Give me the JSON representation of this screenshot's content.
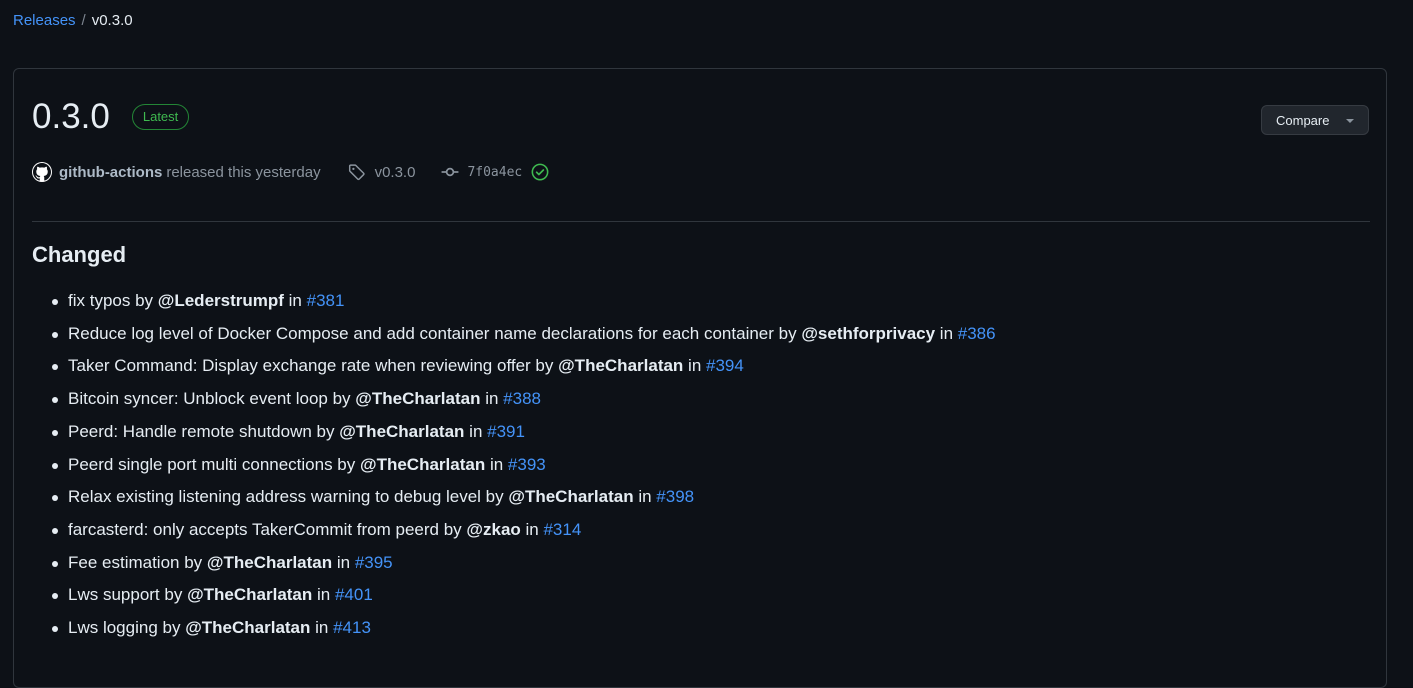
{
  "breadcrumb": {
    "parent": "Releases",
    "separator": "/",
    "current": "v0.3.0"
  },
  "release": {
    "title": "0.3.0",
    "badge": "Latest",
    "compare_label": "Compare",
    "author": "github-actions",
    "released_text": "released this yesterday",
    "tag": "v0.3.0",
    "commit": "7f0a4ec"
  },
  "section": {
    "heading": "Changed",
    "items": [
      {
        "text": "fix typos by ",
        "user": "@Lederstrumpf",
        "in": " in ",
        "pr": "#381"
      },
      {
        "text": "Reduce log level of Docker Compose and add container name declarations for each container by ",
        "user": "@sethforprivacy",
        "in": " in ",
        "pr": "#386"
      },
      {
        "text": "Taker Command: Display exchange rate when reviewing offer by ",
        "user": "@TheCharlatan",
        "in": " in ",
        "pr": "#394"
      },
      {
        "text": "Bitcoin syncer: Unblock event loop by ",
        "user": "@TheCharlatan",
        "in": " in ",
        "pr": "#388"
      },
      {
        "text": "Peerd: Handle remote shutdown by ",
        "user": "@TheCharlatan",
        "in": " in ",
        "pr": "#391"
      },
      {
        "text": "Peerd single port multi connections by ",
        "user": "@TheCharlatan",
        "in": " in ",
        "pr": "#393"
      },
      {
        "text": "Relax existing listening address warning to debug level by ",
        "user": "@TheCharlatan",
        "in": " in ",
        "pr": "#398"
      },
      {
        "text": "farcasterd: only accepts TakerCommit from peerd by ",
        "user": "@zkao",
        "in": " in ",
        "pr": "#314"
      },
      {
        "text": "Fee estimation by ",
        "user": "@TheCharlatan",
        "in": " in ",
        "pr": "#395"
      },
      {
        "text": "Lws support by ",
        "user": "@TheCharlatan",
        "in": " in ",
        "pr": "#401"
      },
      {
        "text": "Lws logging by ",
        "user": "@TheCharlatan",
        "in": " in ",
        "pr": "#413"
      }
    ]
  },
  "colors": {
    "background": "#0d1117",
    "link": "#4493f8",
    "success": "#3fb950",
    "border": "#30363d"
  },
  "icons": {
    "avatar": "github-mark-icon",
    "tag": "tag-icon",
    "commit": "git-commit-icon",
    "verified": "check-circle-icon",
    "dropdown": "triangle-down-icon"
  }
}
